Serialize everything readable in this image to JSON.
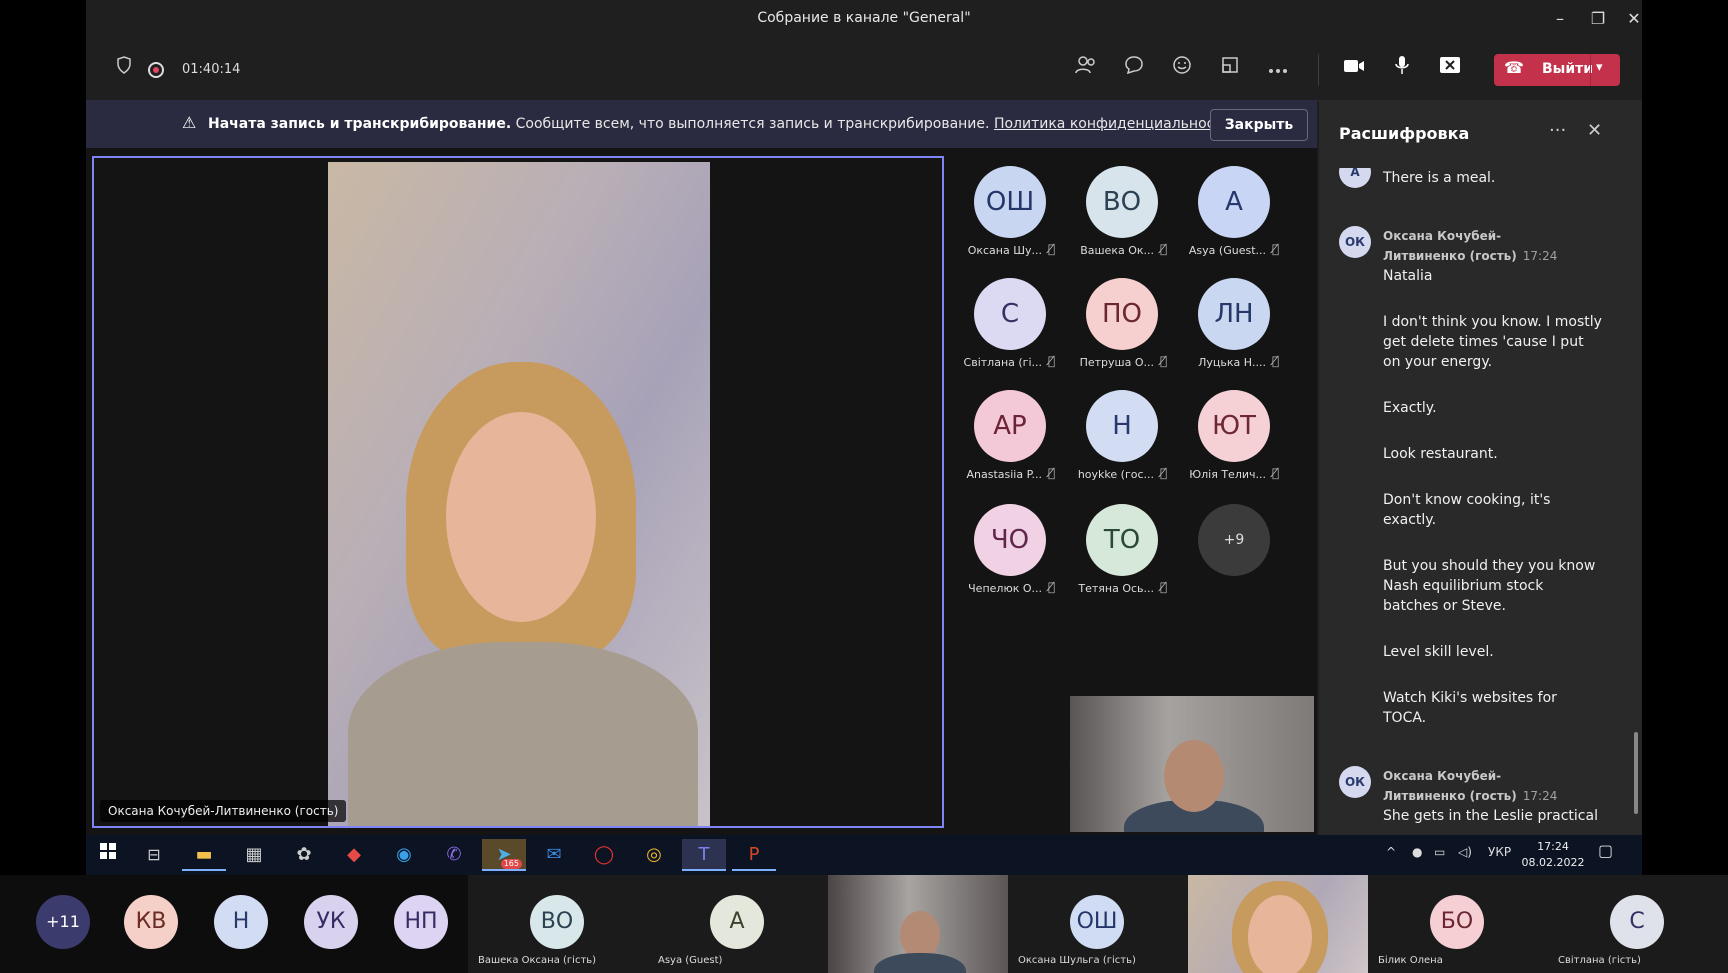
{
  "window": {
    "title": "Собрание в канале \"General\"",
    "minimize": "–",
    "restore": "❐",
    "close": "✕"
  },
  "toolbar": {
    "timer": "01:40:14",
    "leave_label": "Выйти"
  },
  "banner": {
    "bold": "Начата запись и транскрибирование.",
    "text": "Сообщите всем, что выполняется запись и транскрибирование.",
    "link": "Политика конфиденциальности",
    "close_label": "Закрыть"
  },
  "main_video": {
    "name": "Оксана Кочубей-Литвиненко (гость)"
  },
  "participants": [
    {
      "initials": "ОШ",
      "name": "Оксана Шу...",
      "bg": "#c8d6f2",
      "fg": "#25366b"
    },
    {
      "initials": "ВО",
      "name": "Вашека Ок...",
      "bg": "#d8e4ec",
      "fg": "#2c4152"
    },
    {
      "initials": "А",
      "name": "Asya (Guest...",
      "bg": "#c9d5f5",
      "fg": "#27386e"
    },
    {
      "initials": "С",
      "name": "Світлана (гі...",
      "bg": "#dcd9f2",
      "fg": "#363063"
    },
    {
      "initials": "ПО",
      "name": "Петруша О...",
      "bg": "#f6cfcf",
      "fg": "#6b2730"
    },
    {
      "initials": "ЛН",
      "name": "Луцька Н....",
      "bg": "#c9d7f1",
      "fg": "#26386a"
    },
    {
      "initials": "АР",
      "name": "Anastasiia P...",
      "bg": "#f4c9d7",
      "fg": "#6b2338"
    },
    {
      "initials": "Н",
      "name": "hoykke (гос...",
      "bg": "#d2dcf2",
      "fg": "#283a6c"
    },
    {
      "initials": "ЮТ",
      "name": "Юлія Телич...",
      "bg": "#f5d1d6",
      "fg": "#6d2832"
    },
    {
      "initials": "ЧО",
      "name": "Чепелюк О...",
      "bg": "#f0d2e4",
      "fg": "#62264c"
    },
    {
      "initials": "ТО",
      "name": "Тетяна Ось...",
      "bg": "#d6e8da",
      "fg": "#2a4a33"
    }
  ],
  "more_participants": "+9",
  "transcript": {
    "title": "Расшифровка",
    "entries": [
      {
        "type": "text",
        "text": "There is a meal."
      },
      {
        "type": "speaker",
        "initials": "ОК",
        "name": "Оксана Кочубей-Литвиненко (гость)",
        "time": "17:24"
      },
      {
        "type": "text",
        "text": "Natalia"
      },
      {
        "type": "text",
        "text": "I don't think you know. I mostly get delete times 'cause I put on your energy."
      },
      {
        "type": "text",
        "text": "Exactly."
      },
      {
        "type": "text",
        "text": "Look restaurant."
      },
      {
        "type": "text",
        "text": "Don't know cooking, it's exactly."
      },
      {
        "type": "text",
        "text": "But you should they you know Nash equilibrium stock batches or Steve."
      },
      {
        "type": "text",
        "text": "Level skill level."
      },
      {
        "type": "text",
        "text": "Watch Kiki's websites for TOCA."
      },
      {
        "type": "speaker",
        "initials": "ОК",
        "name": "Оксана Кочубей-Литвиненко (гость)",
        "time": "17:24"
      },
      {
        "type": "text",
        "text": "She gets in the Leslie practical"
      }
    ],
    "first_avatar": "А"
  },
  "taskbar": {
    "telegram_badge": "165",
    "lang": "УКР",
    "time": "17:24",
    "date": "08.02.2022"
  },
  "bottom_strip": {
    "overflow": "+11",
    "tiles": [
      {
        "initials": "КВ",
        "bg": "#f4d0c8",
        "fg": "#6b2a22"
      },
      {
        "initials": "Н",
        "bg": "#d2dcf2",
        "fg": "#283a6c"
      },
      {
        "initials": "УК",
        "bg": "#d8d2ee",
        "fg": "#362c63"
      },
      {
        "initials": "НП",
        "bg": "#dcd4f2",
        "fg": "#362c63"
      }
    ],
    "named": [
      {
        "initials": "ВО",
        "name": "Вашека Оксана (гість)",
        "bg": "#d8e8ea",
        "fg": "#2c4152"
      },
      {
        "initials": "А",
        "name": "Asya (Guest)",
        "bg": "#e4e8dc",
        "fg": "#3a432a"
      },
      {
        "initials": "ОШ",
        "name": "Оксана Шульга (гість)",
        "bg": "#d0dcf4",
        "fg": "#25366b"
      },
      {
        "initials": "БО",
        "name": "Білик Олена",
        "bg": "#f6cfd4",
        "fg": "#6b2730"
      },
      {
        "initials": "С",
        "name": "Світлана (гість)",
        "bg": "#dfe2ea",
        "fg": "#363063"
      }
    ]
  }
}
